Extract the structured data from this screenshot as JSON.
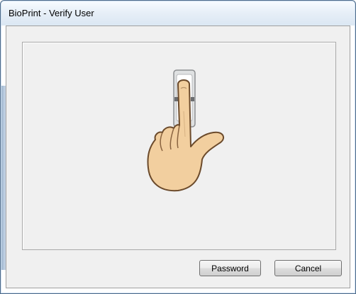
{
  "window": {
    "title": "BioPrint - Verify User"
  },
  "panel": {
    "illustration_icon": "fingerprint-scanner-hand-icon"
  },
  "buttons": {
    "password_label": "Password",
    "cancel_label": "Cancel"
  },
  "colors": {
    "titlebar": "#dbe7f3",
    "client_background": "#f0f0f0",
    "skin": "#f2cf9f",
    "scanner": "#dfe1e2"
  }
}
